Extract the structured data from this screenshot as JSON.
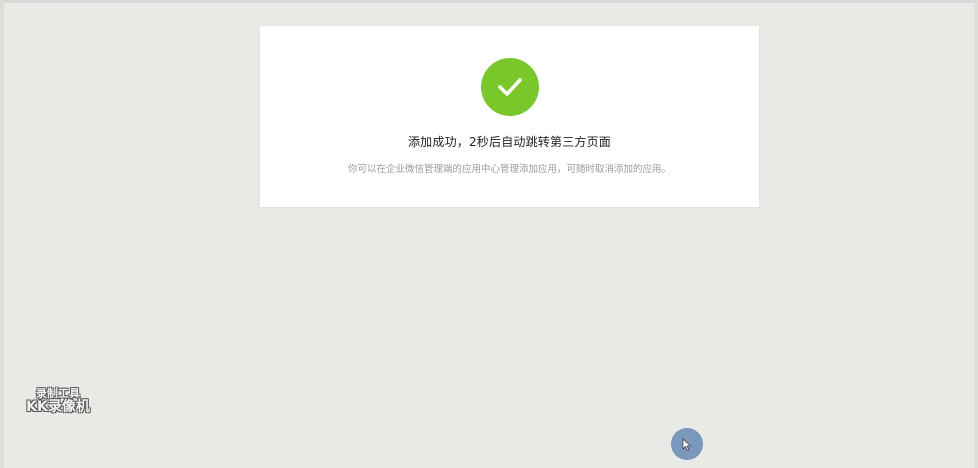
{
  "dialog": {
    "title": "添加成功，2秒后自动跳转第三方页面",
    "description": "你可以在企业微信管理端的应用中心管理添加应用，可随时取消添加的应用。",
    "icon": "check-circle-icon",
    "accent_color": "#79c72a"
  },
  "watermark": {
    "line1": "录制工具",
    "line2": "KK录像机"
  },
  "cursor": {
    "icon": "cursor-arrow-icon",
    "highlight_color": "#6e8fb8"
  }
}
